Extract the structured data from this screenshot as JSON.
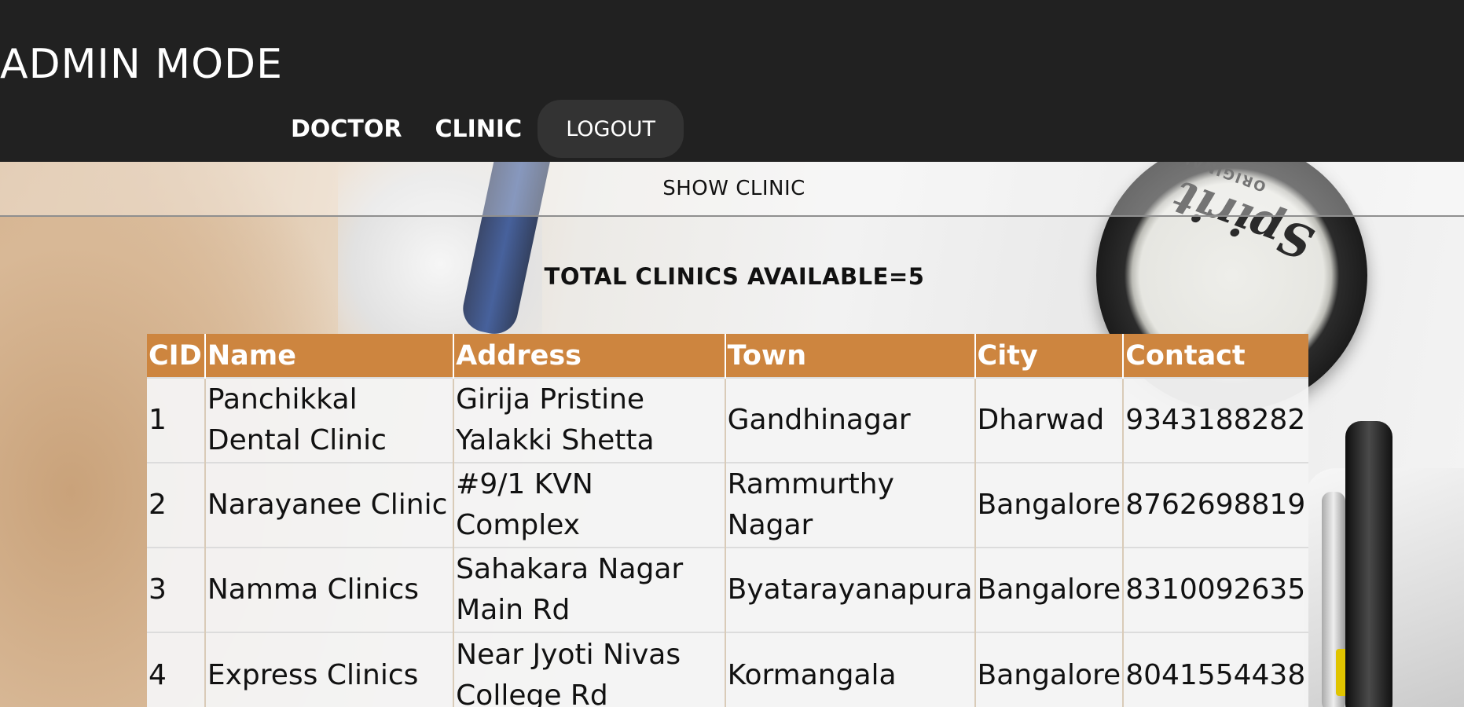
{
  "header": {
    "title": "ADMIN MODE",
    "nav": {
      "doctor": "DOCTOR",
      "clinic": "CLINIC",
      "logout": "LOGOUT"
    }
  },
  "section": {
    "title": "SHOW CLINIC"
  },
  "summary": {
    "total_text": "TOTAL CLINICS AVAILABLE=5"
  },
  "background_photo": {
    "stethoscope_brand": "Spirit",
    "stethoscope_label": "ORIGINAL"
  },
  "table": {
    "columns": [
      "CID",
      "Name",
      "Address",
      "Town",
      "City",
      "Contact"
    ],
    "rows": [
      {
        "cid": "1",
        "name": "Panchikkal Dental Clinic",
        "address": "Girija Pristine Yalakki Shetta",
        "town": "Gandhinagar",
        "city": "Dharwad",
        "contact": "9343188282"
      },
      {
        "cid": "2",
        "name": "Narayanee Clinic",
        "address": "#9/1 KVN Complex",
        "town": "Rammurthy Nagar",
        "city": "Bangalore",
        "contact": "8762698819"
      },
      {
        "cid": "3",
        "name": "Namma Clinics",
        "address": "Sahakara Nagar Main Rd",
        "town": "Byatarayanapura",
        "city": "Bangalore",
        "contact": "8310092635"
      },
      {
        "cid": "4",
        "name": "Express Clinics",
        "address": "Near Jyoti Nivas College Rd",
        "town": "Kormangala",
        "city": "Bangalore",
        "contact": "8041554438"
      }
    ]
  },
  "colors": {
    "header_bg": "#212121",
    "logout_bg": "#333333",
    "table_header_bg": "#cd853f",
    "table_cell_bg": "#f4f4f4"
  }
}
